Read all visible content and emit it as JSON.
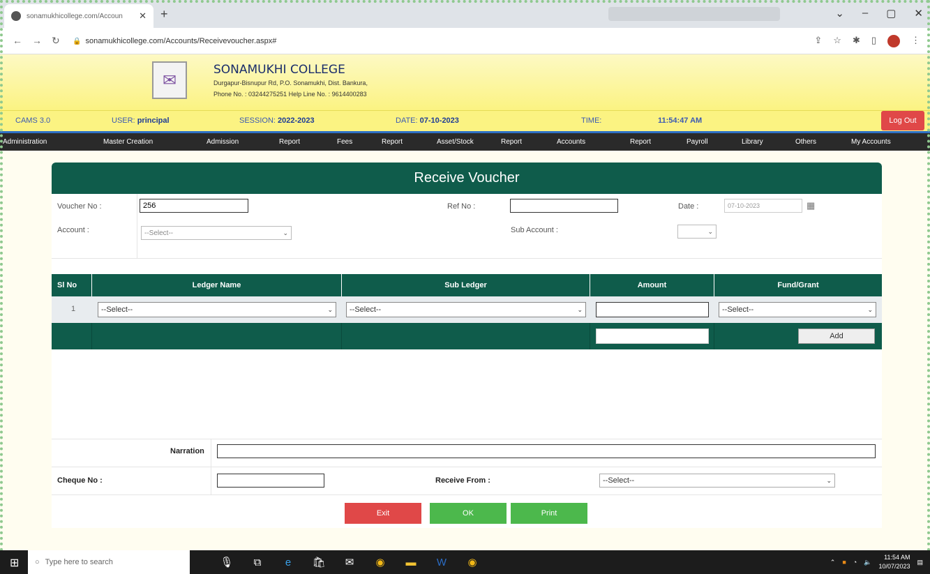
{
  "browser": {
    "tab_title": "sonamukhicollege.com/Accoun",
    "url": "sonamukhicollege.com/Accounts/Receivevoucher.aspx#"
  },
  "site": {
    "college_name": "SONAMUKHI COLLEGE",
    "address": "Durgapur-Bisnupur Rd, P.O. Sonamukhi, Dist. Bankura,",
    "phone": "Phone No. : 03244275251  Help Line No. : 9614400283"
  },
  "infobar": {
    "cams": "CAMS 3.0",
    "user_label": "USER:",
    "user": "principal",
    "session_label": "SESSION:",
    "session": "2022-2023",
    "date_label": "DATE:",
    "date": "07-10-2023",
    "time_label": "TIME:",
    "time": "11:54:47 AM",
    "logout": "Log Out"
  },
  "nav": [
    "Administration",
    "Master Creation",
    "Admission",
    "Report",
    "Fees",
    "Report",
    "Asset/Stock",
    "Report",
    "Accounts",
    "Report",
    "Payroll",
    "Library",
    "Others",
    "My Accounts"
  ],
  "form": {
    "title": "Receive Voucher",
    "voucher_no_label": "Voucher No :",
    "voucher_no": "256",
    "ref_no_label": "Ref No :",
    "ref_no": "",
    "date_label": "Date :",
    "date": "07-10-2023",
    "account_label": "Account :",
    "account_value": "--Select--",
    "sub_account_label": "Sub Account :",
    "sub_account_value": ""
  },
  "grid": {
    "headers": [
      "Sl No",
      "Ledger Name",
      "Sub Ledger",
      "Amount",
      "Fund/Grant"
    ],
    "row": {
      "sl": "1",
      "ledger": "--Select--",
      "sub_ledger": "--Select--",
      "amount": "",
      "fund": "--Select--"
    },
    "add_label": "Add"
  },
  "narration_label": "Narration",
  "cheque_label": "Cheque No :",
  "receive_from_label": "Receive From :",
  "receive_from_value": "--Select--",
  "buttons": {
    "exit": "Exit",
    "ok": "OK",
    "print": "Print"
  },
  "colors": {
    "header_green": "#0f5c4b",
    "exit_red": "#e04848",
    "ok_green": "#4cb84c",
    "logout_red": "#e04848"
  },
  "taskbar": {
    "search_placeholder": "Type here to search",
    "time": "11:54 AM",
    "date": "10/07/2023"
  }
}
